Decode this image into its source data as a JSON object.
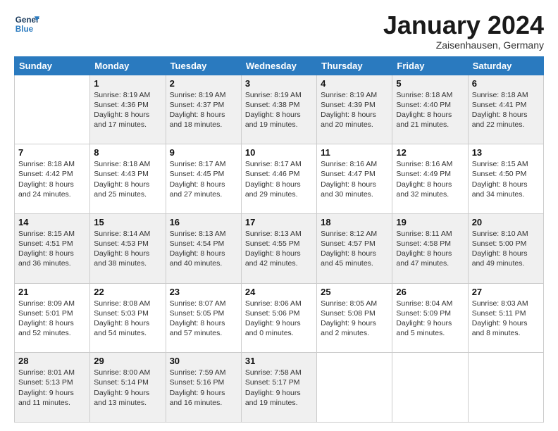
{
  "logo": {
    "line1": "General",
    "line2": "Blue"
  },
  "title": "January 2024",
  "subtitle": "Zaisenhausen, Germany",
  "weekdays": [
    "Sunday",
    "Monday",
    "Tuesday",
    "Wednesday",
    "Thursday",
    "Friday",
    "Saturday"
  ],
  "weeks": [
    [
      {
        "day": "",
        "info": ""
      },
      {
        "day": "1",
        "info": "Sunrise: 8:19 AM\nSunset: 4:36 PM\nDaylight: 8 hours\nand 17 minutes."
      },
      {
        "day": "2",
        "info": "Sunrise: 8:19 AM\nSunset: 4:37 PM\nDaylight: 8 hours\nand 18 minutes."
      },
      {
        "day": "3",
        "info": "Sunrise: 8:19 AM\nSunset: 4:38 PM\nDaylight: 8 hours\nand 19 minutes."
      },
      {
        "day": "4",
        "info": "Sunrise: 8:19 AM\nSunset: 4:39 PM\nDaylight: 8 hours\nand 20 minutes."
      },
      {
        "day": "5",
        "info": "Sunrise: 8:18 AM\nSunset: 4:40 PM\nDaylight: 8 hours\nand 21 minutes."
      },
      {
        "day": "6",
        "info": "Sunrise: 8:18 AM\nSunset: 4:41 PM\nDaylight: 8 hours\nand 22 minutes."
      }
    ],
    [
      {
        "day": "7",
        "info": ""
      },
      {
        "day": "8",
        "info": "Sunrise: 8:18 AM\nSunset: 4:43 PM\nDaylight: 8 hours\nand 25 minutes."
      },
      {
        "day": "9",
        "info": "Sunrise: 8:17 AM\nSunset: 4:45 PM\nDaylight: 8 hours\nand 27 minutes."
      },
      {
        "day": "10",
        "info": "Sunrise: 8:17 AM\nSunset: 4:46 PM\nDaylight: 8 hours\nand 29 minutes."
      },
      {
        "day": "11",
        "info": "Sunrise: 8:16 AM\nSunset: 4:47 PM\nDaylight: 8 hours\nand 30 minutes."
      },
      {
        "day": "12",
        "info": "Sunrise: 8:16 AM\nSunset: 4:49 PM\nDaylight: 8 hours\nand 32 minutes."
      },
      {
        "day": "13",
        "info": "Sunrise: 8:15 AM\nSunset: 4:50 PM\nDaylight: 8 hours\nand 34 minutes."
      }
    ],
    [
      {
        "day": "14",
        "info": ""
      },
      {
        "day": "15",
        "info": "Sunrise: 8:14 AM\nSunset: 4:53 PM\nDaylight: 8 hours\nand 38 minutes."
      },
      {
        "day": "16",
        "info": "Sunrise: 8:13 AM\nSunset: 4:54 PM\nDaylight: 8 hours\nand 40 minutes."
      },
      {
        "day": "17",
        "info": "Sunrise: 8:13 AM\nSunset: 4:55 PM\nDaylight: 8 hours\nand 42 minutes."
      },
      {
        "day": "18",
        "info": "Sunrise: 8:12 AM\nSunset: 4:57 PM\nDaylight: 8 hours\nand 45 minutes."
      },
      {
        "day": "19",
        "info": "Sunrise: 8:11 AM\nSunset: 4:58 PM\nDaylight: 8 hours\nand 47 minutes."
      },
      {
        "day": "20",
        "info": "Sunrise: 8:10 AM\nSunset: 5:00 PM\nDaylight: 8 hours\nand 49 minutes."
      }
    ],
    [
      {
        "day": "21",
        "info": "Sunrise: 8:09 AM\nSunset: 5:01 PM\nDaylight: 8 hours\nand 52 minutes."
      },
      {
        "day": "22",
        "info": "Sunrise: 8:08 AM\nSunset: 5:03 PM\nDaylight: 8 hours\nand 54 minutes."
      },
      {
        "day": "23",
        "info": "Sunrise: 8:07 AM\nSunset: 5:05 PM\nDaylight: 8 hours\nand 57 minutes."
      },
      {
        "day": "24",
        "info": "Sunrise: 8:06 AM\nSunset: 5:06 PM\nDaylight: 9 hours\nand 0 minutes."
      },
      {
        "day": "25",
        "info": "Sunrise: 8:05 AM\nSunset: 5:08 PM\nDaylight: 9 hours\nand 2 minutes."
      },
      {
        "day": "26",
        "info": "Sunrise: 8:04 AM\nSunset: 5:09 PM\nDaylight: 9 hours\nand 5 minutes."
      },
      {
        "day": "27",
        "info": "Sunrise: 8:03 AM\nSunset: 5:11 PM\nDaylight: 9 hours\nand 8 minutes."
      }
    ],
    [
      {
        "day": "28",
        "info": "Sunrise: 8:01 AM\nSunset: 5:13 PM\nDaylight: 9 hours\nand 11 minutes."
      },
      {
        "day": "29",
        "info": "Sunrise: 8:00 AM\nSunset: 5:14 PM\nDaylight: 9 hours\nand 13 minutes."
      },
      {
        "day": "30",
        "info": "Sunrise: 7:59 AM\nSunset: 5:16 PM\nDaylight: 9 hours\nand 16 minutes."
      },
      {
        "day": "31",
        "info": "Sunrise: 7:58 AM\nSunset: 5:17 PM\nDaylight: 9 hours\nand 19 minutes."
      },
      {
        "day": "",
        "info": ""
      },
      {
        "day": "",
        "info": ""
      },
      {
        "day": "",
        "info": ""
      }
    ]
  ],
  "week7_sunday": "Sunrise: 8:18 AM\nSunset: 4:42 PM\nDaylight: 8 hours\nand 24 minutes.",
  "week14_sunday": "Sunrise: 8:15 AM\nSunset: 4:51 PM\nDaylight: 8 hours\nand 36 minutes."
}
